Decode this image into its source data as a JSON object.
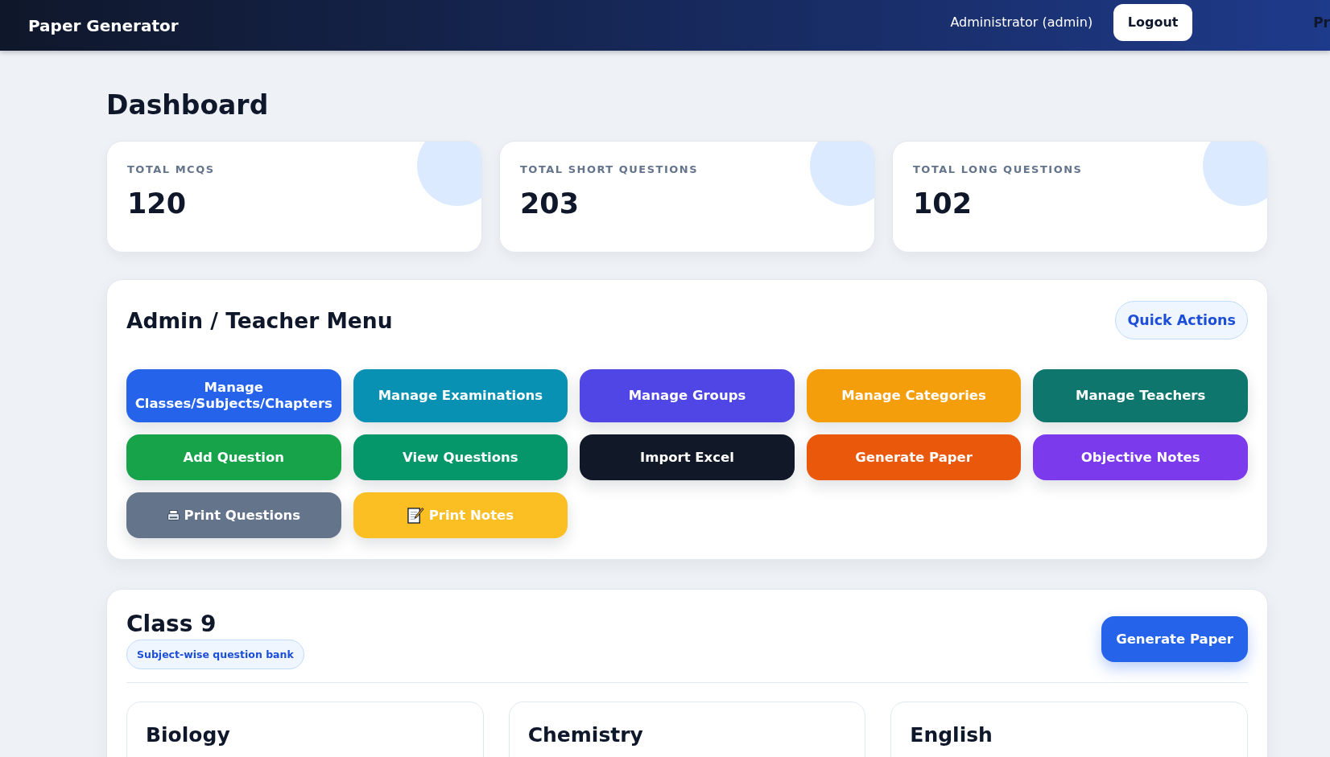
{
  "header": {
    "title": "Paper Generator",
    "user": "Administrator (admin)",
    "logout_button": "Logout",
    "edge_text": "Pr"
  },
  "page_title": "Dashboard",
  "stats": [
    {
      "label": "TOTAL MCQS",
      "value": "120"
    },
    {
      "label": "TOTAL SHORT QUESTIONS",
      "value": "203"
    },
    {
      "label": "TOTAL LONG QUESTIONS",
      "value": "102"
    }
  ],
  "menu": {
    "title": "Admin / Teacher Menu",
    "badge": "Quick Actions",
    "buttons": [
      {
        "label": "Manage Classes/Subjects/Chapters",
        "color": "#2563eb",
        "kind": "plain"
      },
      {
        "label": "Manage Examinations",
        "color": "#0891b2",
        "kind": "plain"
      },
      {
        "label": "Manage Groups",
        "color": "#4f46e5",
        "kind": "plain"
      },
      {
        "label": "Manage Categories",
        "color": "#f59e0b",
        "kind": "plain"
      },
      {
        "label": "Manage Teachers",
        "color": "#0f766e",
        "kind": "plain"
      },
      {
        "label": "Add Question",
        "color": "#16a34a",
        "kind": "plain"
      },
      {
        "label": "View Questions",
        "color": "#059669",
        "kind": "plain"
      },
      {
        "label": "Import Excel",
        "color": "#111827",
        "kind": "plain"
      },
      {
        "label": "Generate Paper",
        "color": "#ea580c",
        "kind": "plain"
      },
      {
        "label": "Objective Notes",
        "color": "#7c3aed",
        "kind": "plain"
      },
      {
        "label": "Print Questions",
        "color": "#64748b",
        "kind": "printer"
      },
      {
        "label": "Print Notes",
        "color": "#fbbf24",
        "kind": "memo"
      }
    ]
  },
  "class_section": {
    "title": "Class 9",
    "badge": "Subject-wise question bank",
    "action_button": "Generate Paper",
    "subjects": [
      {
        "name": "Biology"
      },
      {
        "name": "Chemistry"
      },
      {
        "name": "English"
      }
    ]
  }
}
